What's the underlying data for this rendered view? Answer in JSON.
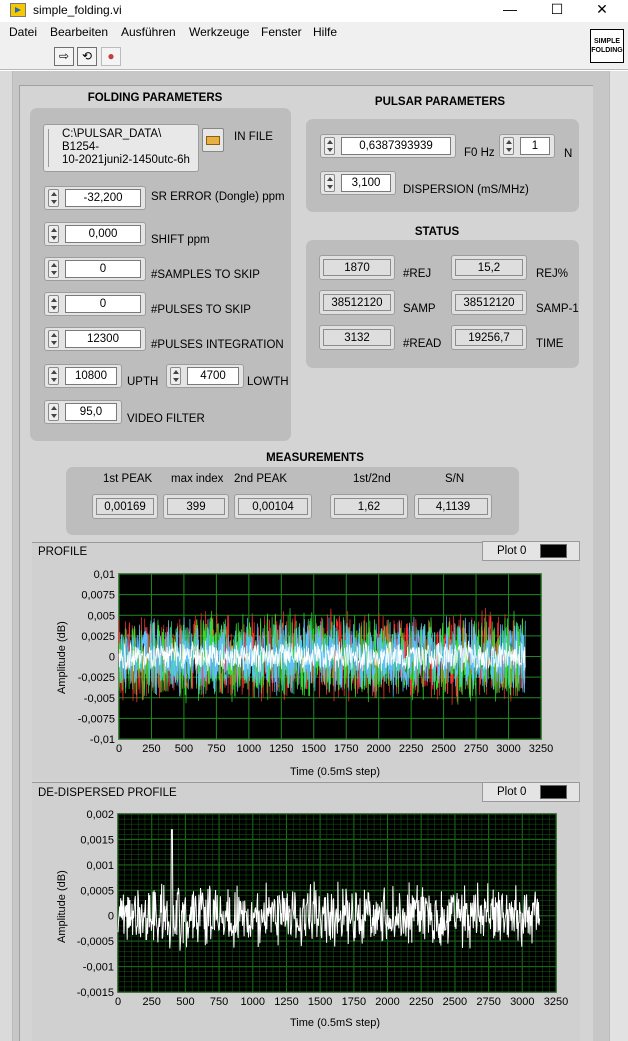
{
  "window": {
    "title": "simple_folding.vi",
    "minimize": "—",
    "maximize": "☐",
    "close": "✕"
  },
  "menu": [
    "Datei",
    "Bearbeiten",
    "Ausführen",
    "Werkzeuge",
    "Fenster",
    "Hilfe"
  ],
  "toolbar": {
    "run_glyph": "⇨",
    "run_cont_glyph": "⟲",
    "abort_glyph": "●"
  },
  "logo": {
    "line1": "SIMPLE",
    "line2": "FOLDING"
  },
  "folding": {
    "header": "FOLDING PARAMETERS",
    "in_file_label": "IN FILE",
    "in_file_value": [
      "C:\\PULSAR_DATA\\",
      "B1254-",
      "10-2021juni2-1450utc-6h"
    ],
    "sr_error": {
      "label": "SR ERROR (Dongle) ppm",
      "value": "-32,200"
    },
    "shift": {
      "label": "SHIFT ppm",
      "value": "0,000"
    },
    "samples_skip": {
      "label": "#SAMPLES TO SKIP",
      "value": "0"
    },
    "pulses_skip": {
      "label": "#PULSES TO SKIP",
      "value": "0"
    },
    "pulses_integration": {
      "label": "#PULSES INTEGRATION",
      "value": "12300"
    },
    "upth": {
      "label": "UPTH",
      "value": "10800"
    },
    "lowth": {
      "label": "LOWTH",
      "value": "4700"
    },
    "video_filter": {
      "label": "VIDEO FILTER",
      "value": "95,0"
    }
  },
  "pulsar": {
    "header": "PULSAR PARAMETERS",
    "f0": {
      "label": "F0 Hz",
      "value": "0,6387393939"
    },
    "n": {
      "label": "N",
      "value": "1"
    },
    "dispersion": {
      "label": "DISPERSION (mS/MHz)",
      "value": "3,100"
    }
  },
  "status": {
    "header": "STATUS",
    "rej": {
      "label": "#REJ",
      "value": "1870"
    },
    "rej_pct": {
      "label": "REJ%",
      "value": "15,2"
    },
    "samp": {
      "label": "SAMP",
      "value": "38512120"
    },
    "samp1": {
      "label": "SAMP-1",
      "value": "38512120"
    },
    "read": {
      "label": "#READ",
      "value": "3132"
    },
    "time": {
      "label": "TIME",
      "value": "19256,7"
    }
  },
  "measurements": {
    "header": "MEASUREMENTS",
    "first_peak": {
      "label": "1st PEAK",
      "value": "0,00169"
    },
    "max_index": {
      "label": "max index",
      "value": "399"
    },
    "second_peak": {
      "label": "2nd PEAK",
      "value": "0,00104"
    },
    "ratio": {
      "label": "1st/2nd",
      "value": "1,62"
    },
    "sn": {
      "label": "S/N",
      "value": "4,1139"
    }
  },
  "colors": {
    "plot_bg": "#000000",
    "grid": "#1f8a1f",
    "trace_white": "#ffffff",
    "trace_red": "#ff3030",
    "trace_green": "#30e030",
    "trace_cyan": "#60c0ff"
  },
  "chart_data": [
    {
      "type": "line",
      "title": "PROFILE",
      "legend": "Plot 0",
      "xlabel": "Time (0.5mS step)",
      "ylabel": "Amplitude (dB)",
      "xlim": [
        0,
        3250
      ],
      "ylim": [
        -0.01,
        0.01
      ],
      "x_ticks": [
        "0",
        "250",
        "500",
        "750",
        "1000",
        "1250",
        "1500",
        "1750",
        "2000",
        "2250",
        "2500",
        "2750",
        "3000",
        "3250"
      ],
      "y_ticks": [
        "0,01",
        "0,0075",
        "0,005",
        "0,0025",
        "0",
        "-0,0025",
        "-0,005",
        "-0,0075",
        "-0,01"
      ],
      "grid": true,
      "n_points": 3132,
      "series": [
        {
          "color": "#ff3030",
          "values": [
            0.002,
            -0.003,
            0.006,
            -0.004,
            0.003,
            -0.006,
            0.005,
            -0.002,
            0.004,
            -0.005
          ]
        },
        {
          "color": "#30e030",
          "values": [
            -0.002,
            0.004,
            -0.005,
            0.003,
            -0.004,
            0.005,
            -0.003,
            0.006,
            -0.002,
            0.004
          ]
        },
        {
          "color": "#60c0ff",
          "values": [
            0.003,
            -0.004,
            0.004,
            -0.003,
            0.005,
            -0.004,
            0.003,
            -0.005,
            0.004,
            -0.003
          ]
        },
        {
          "color": "#ffffff",
          "values": [
            0.001,
            -0.002,
            0.002,
            -0.001,
            0.002,
            -0.002,
            0.001,
            -0.002,
            0.002,
            -0.001
          ]
        }
      ]
    },
    {
      "type": "line",
      "title": "DE-DISPERSED PROFILE",
      "legend": "Plot 0",
      "xlabel": "Time (0.5mS step)",
      "ylabel": "Amplitude (dB)",
      "xlim": [
        0,
        3250
      ],
      "ylim": [
        -0.0015,
        0.002
      ],
      "x_ticks": [
        "0",
        "250",
        "500",
        "750",
        "1000",
        "1250",
        "1500",
        "1750",
        "2000",
        "2250",
        "2500",
        "2750",
        "3000",
        "3250"
      ],
      "y_ticks": [
        "0,002",
        "0,0015",
        "0,001",
        "0,0005",
        "0",
        "-0,0005",
        "-0,001",
        "-0,0015"
      ],
      "grid": true,
      "n_points": 3132,
      "peak": {
        "x": 399,
        "y": 0.00169
      },
      "series": [
        {
          "color": "#ffffff"
        }
      ]
    }
  ]
}
